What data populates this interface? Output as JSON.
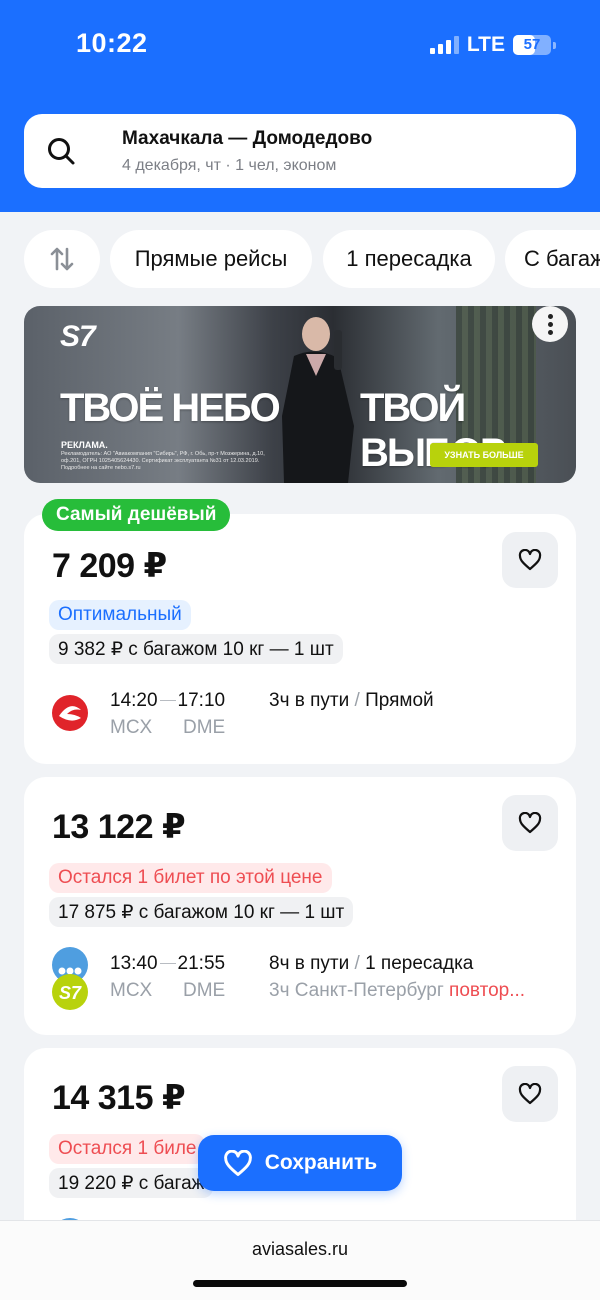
{
  "status": {
    "time": "10:22",
    "network": "LTE",
    "battery": "57",
    "battery_level": 0.57
  },
  "search": {
    "title": "Махачкала — Домодедово",
    "subtitle": "4 декабря, чт · 1 чел, эконом"
  },
  "filters": [
    "Прямые рейсы",
    "1 пересадка",
    "С багаж"
  ],
  "ad": {
    "logo": "S7",
    "headline_left": "ТВОЁ НЕБО",
    "headline_right": "ТВОЙ ВЫБОР",
    "label": "РЕКЛАМА.",
    "disclaimer": "Рекламодатель: АО \"Авиакомпания \"Сибирь\", РФ, г. Обь, пр-т Мозжерина, д.10, оф.201, ОГРН 1025405624430. Сертификат эксплуатанта №31 от 12.03.2019. Подробнее на сайте nebo.s7.ru",
    "cta": "УЗНАТЬ БОЛЬШЕ"
  },
  "cheapest_badge": "Самый дешёвый",
  "tickets": [
    {
      "price": "7 209 ₽",
      "tag": "Оптимальный",
      "baggage": "9 382 ₽ с багажом 10 кг — 1 шт",
      "dep_time": "14:20",
      "arr_time": "17:10",
      "dep_code": "MCX",
      "arr_code": "DME",
      "duration": "3ч в пути",
      "sep": " / ",
      "route": "Прямой"
    },
    {
      "price": "13 122 ₽",
      "tag": "Остался 1 билет по этой цене",
      "baggage": "17 875 ₽ с багажом 10 кг — 1 шт",
      "dep_time": "13:40",
      "arr_time": "21:55",
      "dep_code": "MCX",
      "arr_code": "DME",
      "duration": "8ч в пути",
      "sep": " / ",
      "route": "1 пересадка",
      "layover": "3ч Санкт-Петербург",
      "layover_warn": "повтор..."
    },
    {
      "price": "14 315 ₽",
      "tag": "Остался 1 биле",
      "baggage": "19 220 ₽ с багаж"
    }
  ],
  "save_button": "Сохранить",
  "browser": {
    "url": "aviasales.ru"
  },
  "colors": {
    "brand": "#1b6fff",
    "cheap": "#27bd3a",
    "warn": "#ee4d52",
    "s7": "#b8d20c"
  }
}
